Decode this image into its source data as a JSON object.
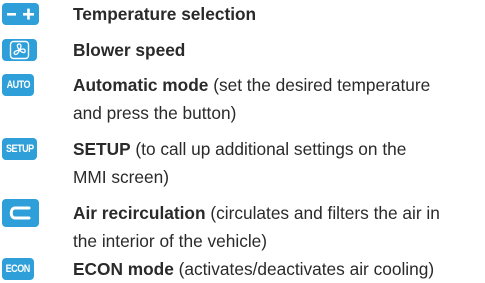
{
  "icon_color": "#2e9fd9",
  "items": [
    {
      "icon": "minus-plus-icon",
      "bold": "Temperature selection",
      "rest": "",
      "cont": ""
    },
    {
      "icon": "fan-icon",
      "bold": "Blower speed",
      "rest": "",
      "cont": ""
    },
    {
      "icon": "auto-icon",
      "icon_text": "AUTO",
      "bold": "Automatic mode",
      "rest": " (set the desired temperature",
      "cont": "and press the button)"
    },
    {
      "icon": "setup-icon",
      "icon_text": "SETUP",
      "bold": "SETUP",
      "rest": " (to call up additional settings on the",
      "cont": "MMI screen)"
    },
    {
      "icon": "recirculation-icon",
      "bold": "Air recirculation",
      "rest": " (circulates and filters the air in",
      "cont": "the interior of the vehicle)"
    },
    {
      "icon": "econ-icon",
      "icon_text": "ECON",
      "bold": "ECON mode",
      "rest": " (activates/deactivates air cooling)",
      "cont": ""
    }
  ]
}
